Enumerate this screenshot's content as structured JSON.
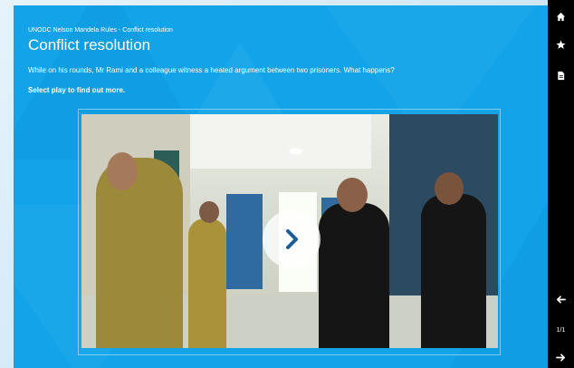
{
  "course": {
    "breadcrumb": "UNODC Nelson Mandela Rules - Conflict resolution",
    "title": "Conflict resolution",
    "description": "While on his rounds, Mr Rami and a colleague witness a heated argument between two prisoners. What happens?",
    "instruction": "Select play to find out more."
  },
  "video": {
    "play_icon": "chevron-right-icon"
  },
  "toolbar": {
    "home_icon": "home-icon",
    "bookmark_icon": "star-icon",
    "document_icon": "document-icon",
    "back_icon": "arrow-left-icon",
    "next_icon": "arrow-right-icon",
    "page_counter": "1/1"
  },
  "colors": {
    "panel_blue": "#12a3e8",
    "toolbar_black": "#000000",
    "text_white": "#ffffff",
    "play_chevron": "#1b5d97"
  }
}
